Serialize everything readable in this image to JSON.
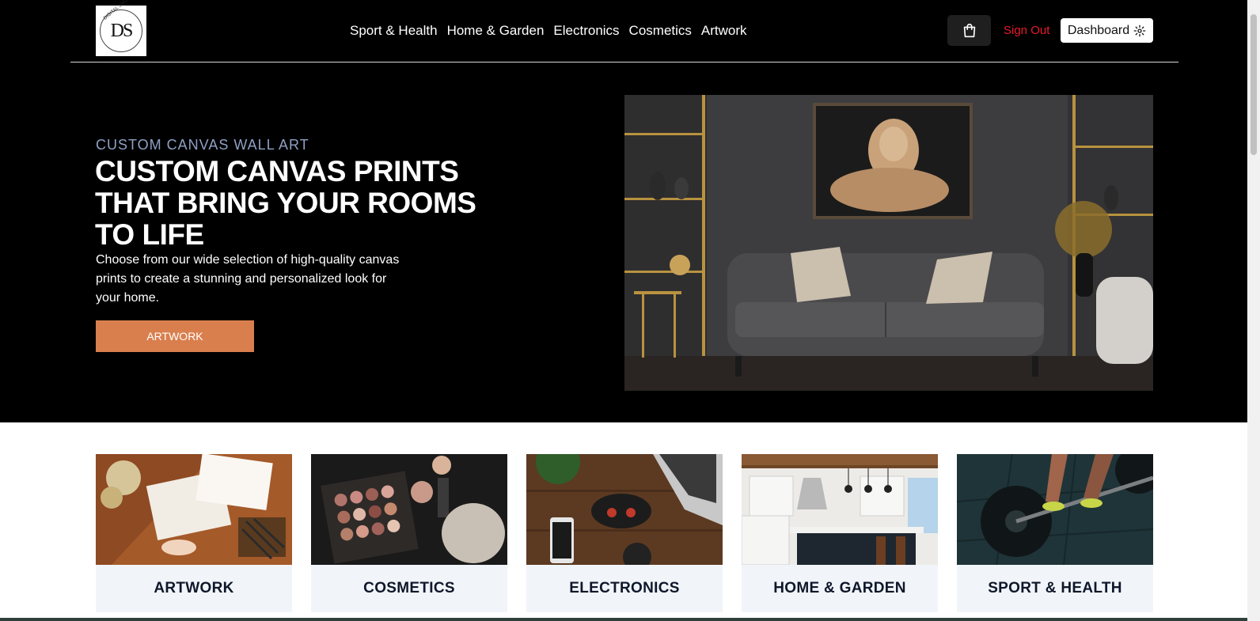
{
  "logo": {
    "initials": "DS",
    "ring_text": "DIGITAL SHOPPER"
  },
  "nav": {
    "items": [
      "Sport & Health",
      "Home & Garden",
      "Electronics",
      "Cosmetics",
      "Artwork"
    ]
  },
  "header": {
    "cart_icon": "shopping-bag-icon",
    "signout_label": "Sign Out",
    "dashboard_label": "Dashboard",
    "dashboard_icon": "gear-icon"
  },
  "hero": {
    "eyebrow": "CUSTOM CANVAS WALL ART",
    "headline": "CUSTOM CANVAS PRINTS THAT BRING YOUR ROOMS TO LIFE",
    "subtext": "Choose from our wide selection of high-quality canvas prints to create a stunning and personalized look for your home.",
    "cta_label": "ARTWORK"
  },
  "categories": [
    {
      "label": "ARTWORK"
    },
    {
      "label": "COSMETICS"
    },
    {
      "label": "ELECTRONICS"
    },
    {
      "label": "HOME & GARDEN"
    },
    {
      "label": "SPORT & HEALTH"
    }
  ],
  "colors": {
    "hero_bg": "#000000",
    "accent": "#d97f4e",
    "signout": "#e8192a",
    "eyebrow": "#8fa1c4",
    "card_bg": "#f1f5f9"
  }
}
